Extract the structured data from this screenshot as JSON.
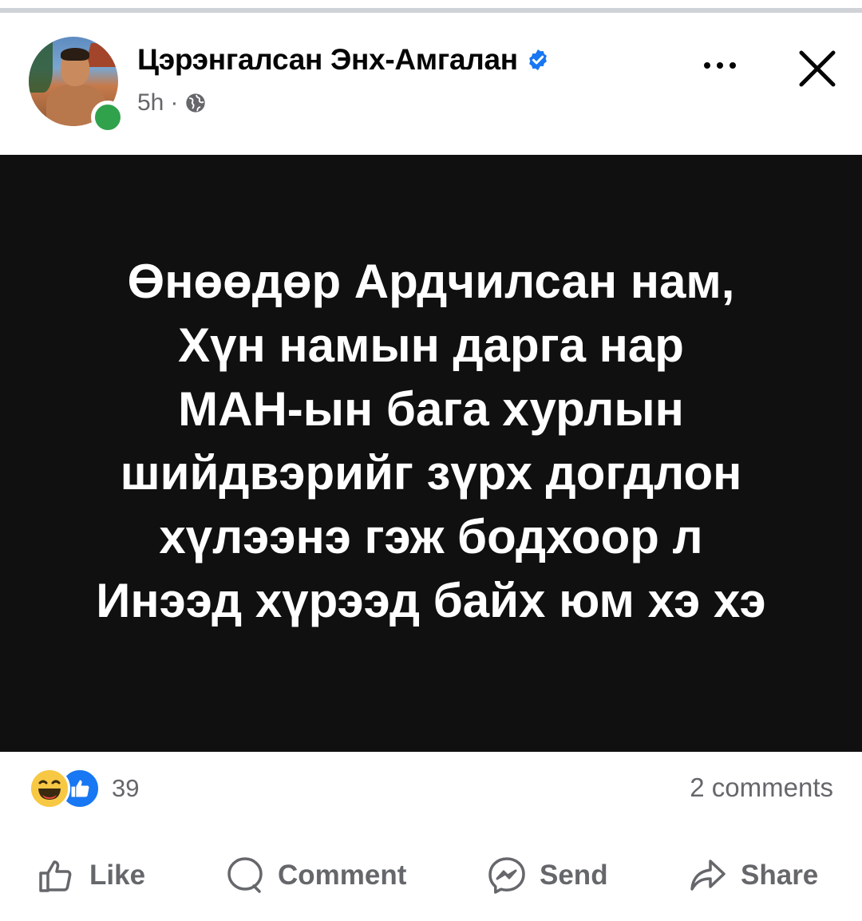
{
  "post": {
    "author": "Цэрэнгалсан Энх-Амгалан",
    "time": "5h",
    "separator": "·",
    "text_lines": [
      "Өнөөдөр Ардчилсан нам,",
      "Хүн намын дарга нар",
      "МАН-ын бага хурлын",
      "шийдвэрийг зүрх догдлон",
      "хүлээнэ гэж бодхоор л",
      "Инээд хүрээд байх юм хэ хэ"
    ]
  },
  "reactions": {
    "count": "39",
    "types": [
      "haha-emoji-icon",
      "like-emoji-icon"
    ]
  },
  "comments": {
    "label": "2 comments"
  },
  "actions": {
    "like": "Like",
    "comment": "Comment",
    "send": "Send",
    "share": "Share"
  },
  "colors": {
    "verified": "#1877f2",
    "online": "#31a24c",
    "secondary_text": "#65676b",
    "post_background": "#101010"
  }
}
